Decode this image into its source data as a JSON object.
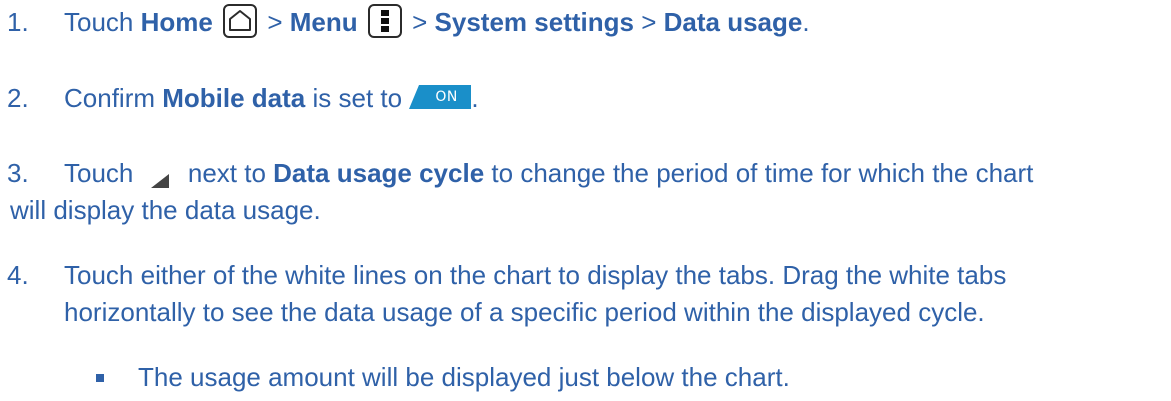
{
  "steps": [
    {
      "number": "1.",
      "touch": "Touch",
      "home": "Home",
      "sep1": ">",
      "menu": "Menu",
      "sep2": ">",
      "system_settings": "System settings",
      "sep3": ">",
      "data_usage": "Data usage",
      "end": "."
    },
    {
      "number": "2.",
      "confirm": "Confirm",
      "mobile_data": "Mobile data",
      "is_set_to": "is set to",
      "toggle_label": "ON",
      "end": "."
    },
    {
      "number": "3.",
      "touch": "Touch",
      "next_to": "next to",
      "data_usage_cycle": "Data usage cycle",
      "rest": "to change the period of time for which the chart",
      "line2": "will display the data usage."
    },
    {
      "number": "4.",
      "line1": "Touch either of the white lines on the chart to display the tabs. Drag the white tabs",
      "line2": "horizontally to see the data usage of a specific period within the displayed cycle."
    }
  ],
  "bullet": {
    "text": "The usage amount will be displayed just below the chart."
  },
  "colors": {
    "text": "#2f61a8",
    "toggle": "#1a8fc9",
    "icon_border": "#2b2b2b"
  },
  "icons": {
    "home": "home-icon",
    "menu": "menu-icon",
    "toggle": "toggle-switch-on-icon",
    "dropdown": "spinner-triangle-icon"
  }
}
